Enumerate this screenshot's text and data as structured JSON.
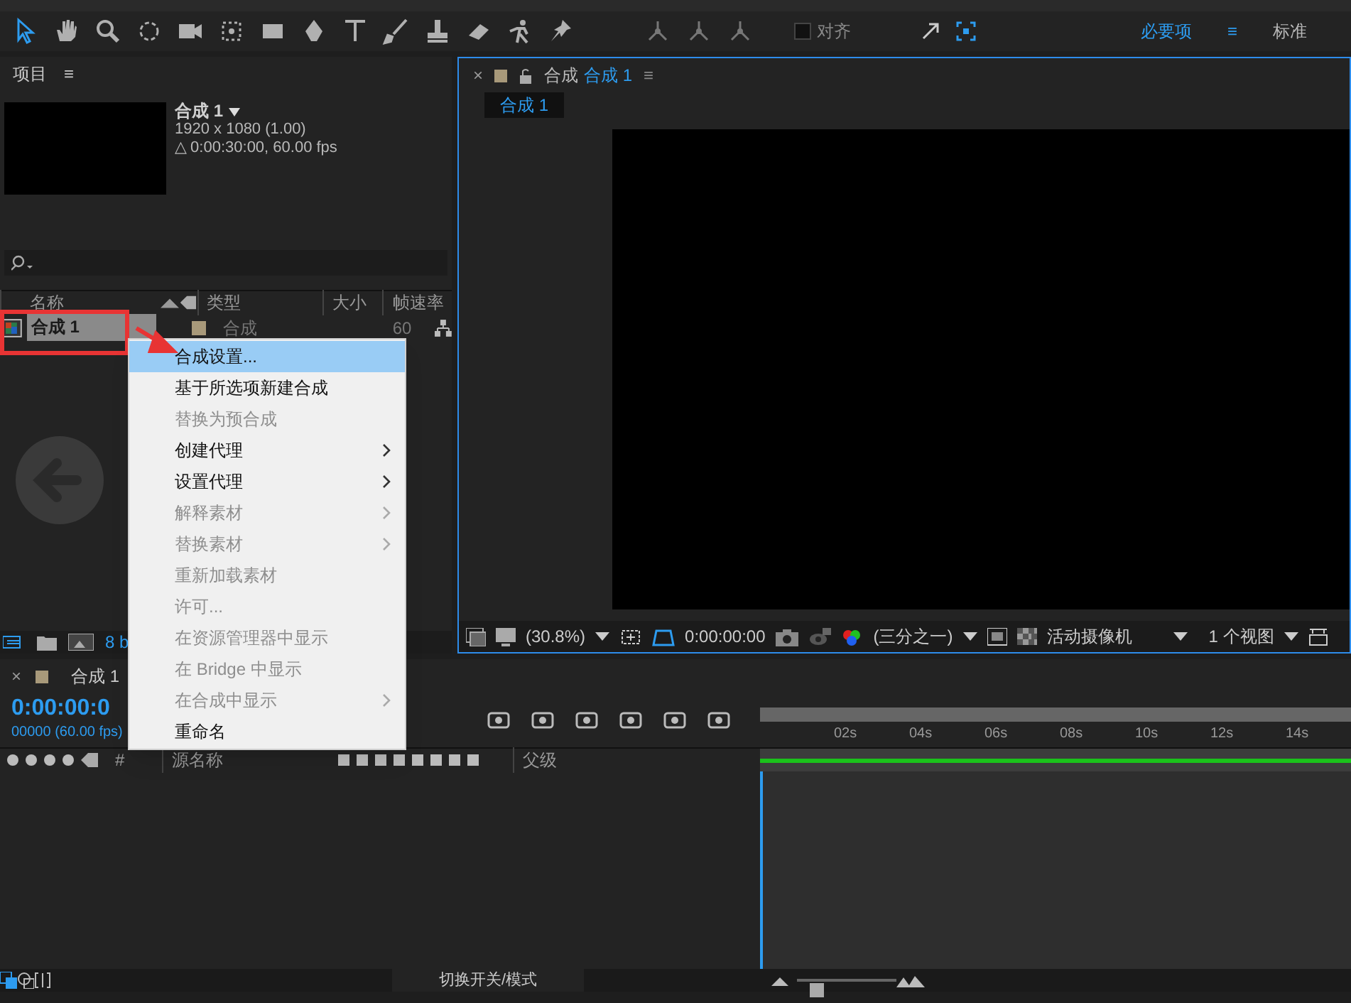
{
  "toolbar": {
    "snap": {
      "label": "对齐",
      "checked": false
    },
    "workspaces": [
      {
        "label": "必要项",
        "selected": true
      },
      {
        "label": "标准",
        "selected": false
      }
    ],
    "menu_glyph": "≡",
    "close_glyph": "×",
    "zoom": {
      "level": 0.15
    }
  },
  "project": {
    "title": "项目",
    "menu_glyph": "≡",
    "comp_name": "合成 1",
    "comp_size": "1920 x 1080 (1.00)",
    "comp_duration": "△ 0:00:30:00, 60.00 fps",
    "columns": [
      "名称",
      "类型",
      "大小",
      "帧速率"
    ],
    "rows": [
      {
        "name": "合成 1",
        "type": "合成",
        "framerate": "60",
        "selected": true,
        "color": "#a8997a"
      }
    ],
    "bpc": "8 b"
  },
  "viewer": {
    "tab_prefix": "合成",
    "tab_name": "合成 1",
    "subtab": "合成 1",
    "zoom": "(30.8%)",
    "timecode": "0:00:00:00",
    "resolution": "(三分之一)",
    "camera": "活动摄像机",
    "views": "1 个视图"
  },
  "timeline": {
    "tab": "合成 1",
    "timecode": "0:00:00:0",
    "frames": "00000 (60.00 fps)",
    "columns": [
      "#",
      "源名称",
      "父级"
    ],
    "ruler": [
      "02s",
      "04s",
      "06s",
      "08s",
      "10s",
      "12s",
      "14s"
    ],
    "mode_toggle": "切换开关/模式"
  },
  "context_menu": {
    "items": [
      {
        "label": "合成设置...",
        "selected": true,
        "disabled": false,
        "submenu": false
      },
      {
        "label": "基于所选项新建合成",
        "selected": false,
        "disabled": false,
        "submenu": false
      },
      {
        "label": "替换为预合成",
        "selected": false,
        "disabled": true,
        "submenu": false
      },
      {
        "label": "创建代理",
        "selected": false,
        "disabled": false,
        "submenu": true
      },
      {
        "label": "设置代理",
        "selected": false,
        "disabled": false,
        "submenu": true
      },
      {
        "label": "解释素材",
        "selected": false,
        "disabled": true,
        "submenu": true
      },
      {
        "label": "替换素材",
        "selected": false,
        "disabled": true,
        "submenu": true
      },
      {
        "label": "重新加载素材",
        "selected": false,
        "disabled": true,
        "submenu": false
      },
      {
        "label": "许可...",
        "selected": false,
        "disabled": true,
        "submenu": false
      },
      {
        "label": "在资源管理器中显示",
        "selected": false,
        "disabled": true,
        "submenu": false
      },
      {
        "label": "在 Bridge 中显示",
        "selected": false,
        "disabled": true,
        "submenu": false
      },
      {
        "label": "在合成中显示",
        "selected": false,
        "disabled": true,
        "submenu": true
      },
      {
        "label": "重命名",
        "selected": false,
        "disabled": false,
        "submenu": false
      }
    ]
  }
}
